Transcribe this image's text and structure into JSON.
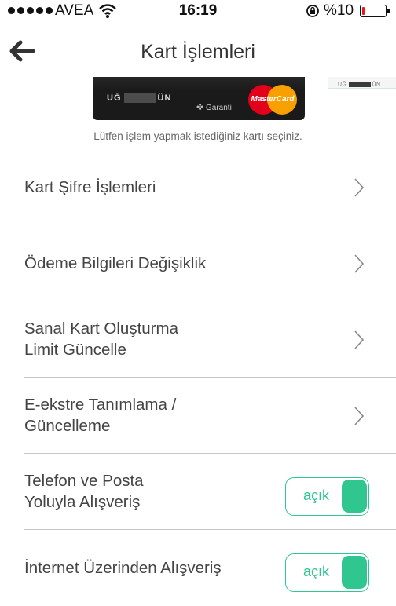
{
  "status_bar": {
    "carrier": "AVEA",
    "time": "16:19",
    "battery_text": "%10",
    "battery_level": 0.1,
    "battery_color": "#e21b1b"
  },
  "nav": {
    "title": "Kart İşlemleri",
    "back_icon": "arrow-left-icon"
  },
  "card": {
    "holder_prefix": "UĞ",
    "holder_suffix": "ÜN",
    "bank_label": "Garanti",
    "brand_label": "MasterCard"
  },
  "card_peek": {
    "holder_prefix": "UĞ",
    "holder_suffix": "ÜN"
  },
  "hint": "Lütfen işlem yapmak istediğiniz kartı seçiniz.",
  "menu": {
    "items": [
      {
        "label_lines": [
          "Kart Şifre İşlemleri"
        ],
        "type": "link"
      },
      {
        "label_lines": [
          "Ödeme Bilgileri Değişiklik"
        ],
        "type": "link"
      },
      {
        "label_lines": [
          "Sanal Kart Oluşturma",
          "Limit Güncelle"
        ],
        "type": "link"
      },
      {
        "label_lines": [
          "E-ekstre Tanımlama /",
          "Güncelleme"
        ],
        "type": "link"
      },
      {
        "label_lines": [
          "Telefon ve Posta",
          "Yoluyla Alışveriş"
        ],
        "type": "toggle",
        "toggle_label": "açık",
        "toggle_on": true
      },
      {
        "label_lines": [
          "İnternet Üzerinden Alışveriş"
        ],
        "type": "toggle",
        "toggle_label": "açık",
        "toggle_on": true
      }
    ]
  },
  "colors": {
    "accent": "#2fc690",
    "divider": "#c8c8c8"
  }
}
